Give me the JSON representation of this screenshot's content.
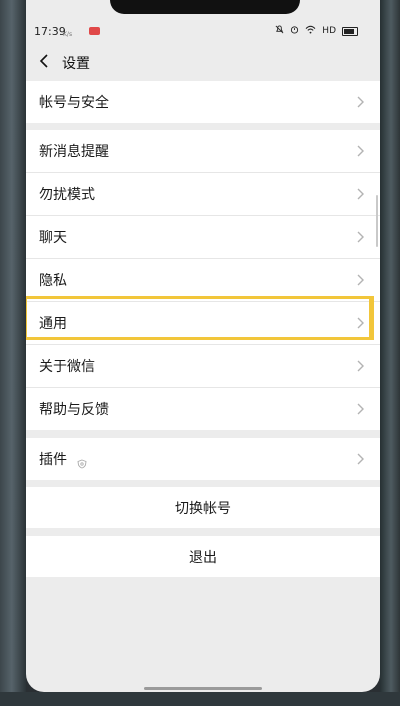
{
  "status_bar": {
    "time": "17:39",
    "small_text": "K/s",
    "network": "HD",
    "icons": [
      "mute-icon",
      "alarm-icon",
      "wifi-icon",
      "battery-icon"
    ]
  },
  "header": {
    "title": "设置"
  },
  "groups": [
    {
      "items": [
        {
          "label": "帐号与安全"
        }
      ]
    },
    {
      "items": [
        {
          "label": "新消息提醒"
        },
        {
          "label": "勿扰模式"
        },
        {
          "label": "聊天"
        },
        {
          "label": "隐私"
        },
        {
          "label": "通用",
          "highlighted": true
        },
        {
          "label": "关于微信"
        },
        {
          "label": "帮助与反馈"
        }
      ]
    },
    {
      "items": [
        {
          "label": "插件",
          "icon": "plugin-shield-icon"
        }
      ]
    }
  ],
  "actions": {
    "switch_account": "切换帐号",
    "logout": "退出"
  },
  "colors": {
    "highlight": "#f2c63a",
    "background": "#ececec",
    "row_background": "#ffffff"
  }
}
